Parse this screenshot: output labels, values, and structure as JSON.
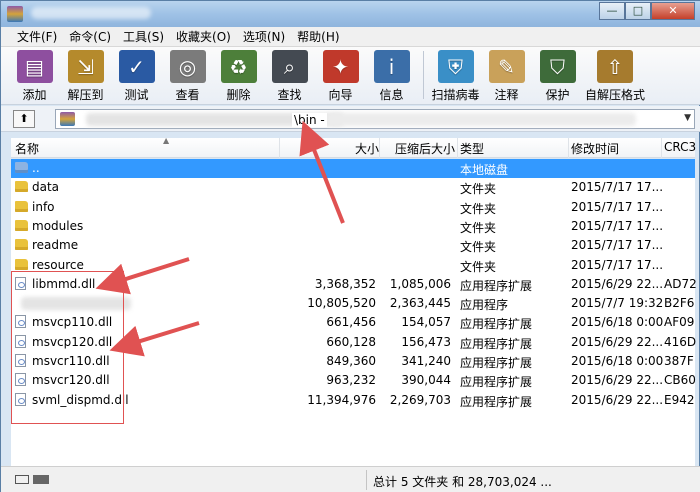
{
  "menu": [
    "文件(F)",
    "命令(C)",
    "工具(S)",
    "收藏夹(O)",
    "选项(N)",
    "帮助(H)"
  ],
  "toolbar": [
    {
      "label": "添加",
      "icon": "add-archive-icon",
      "color": "#8e4f9f"
    },
    {
      "label": "解压到",
      "icon": "extract-to-icon",
      "color": "#b58a2c"
    },
    {
      "label": "测试",
      "icon": "test-icon",
      "color": "#2a5aa3"
    },
    {
      "label": "查看",
      "icon": "view-icon",
      "color": "#7b7b7b"
    },
    {
      "label": "删除",
      "icon": "delete-icon",
      "color": "#4d7f3a"
    },
    {
      "label": "查找",
      "icon": "find-icon",
      "color": "#444a52"
    },
    {
      "label": "向导",
      "icon": "wizard-icon",
      "color": "#c0392b"
    },
    {
      "label": "信息",
      "icon": "info-icon",
      "color": "#3b6ea8"
    },
    {
      "label": "扫描病毒",
      "icon": "scan-virus-icon",
      "color": "#3a8fc7"
    },
    {
      "label": "注释",
      "icon": "comment-icon",
      "color": "#c9a15a"
    },
    {
      "label": "保护",
      "icon": "protect-icon",
      "color": "#3e6b3a"
    },
    {
      "label": "自解压格式",
      "icon": "sfx-icon",
      "color": "#a67b2e"
    }
  ],
  "address": {
    "path_visible": "\\bin - "
  },
  "columns": [
    "名称",
    "大小",
    "压缩后大小",
    "类型",
    "修改时间",
    "CRC3"
  ],
  "rows": [
    {
      "name": "..",
      "size": "",
      "packed": "",
      "type": "本地磁盘",
      "modified": "",
      "crc": "",
      "icon": "folder-up-icon",
      "selected": true
    },
    {
      "name": "data",
      "size": "",
      "packed": "",
      "type": "文件夹",
      "modified": "2015/7/17 17...",
      "crc": "",
      "icon": "folder-icon"
    },
    {
      "name": "info",
      "size": "",
      "packed": "",
      "type": "文件夹",
      "modified": "2015/7/17 17...",
      "crc": "",
      "icon": "folder-icon"
    },
    {
      "name": "modules",
      "size": "",
      "packed": "",
      "type": "文件夹",
      "modified": "2015/7/17 17...",
      "crc": "",
      "icon": "folder-icon"
    },
    {
      "name": "readme",
      "size": "",
      "packed": "",
      "type": "文件夹",
      "modified": "2015/7/17 17...",
      "crc": "",
      "icon": "folder-icon"
    },
    {
      "name": "resource",
      "size": "",
      "packed": "",
      "type": "文件夹",
      "modified": "2015/7/17 17...",
      "crc": "",
      "icon": "folder-icon"
    },
    {
      "name": "libmmd.dll",
      "size": "3,368,352",
      "packed": "1,085,006",
      "type": "应用程序扩展",
      "modified": "2015/6/29 22...",
      "crc": "AD72",
      "icon": "dll-icon"
    },
    {
      "name": "",
      "size": "10,805,520",
      "packed": "2,363,445",
      "type": "应用程序",
      "modified": "2015/7/7 19:32",
      "crc": "B2F6",
      "icon": "blurred",
      "blurred": true
    },
    {
      "name": "msvcp110.dll",
      "size": "661,456",
      "packed": "154,057",
      "type": "应用程序扩展",
      "modified": "2015/6/18 0:00",
      "crc": "AF09",
      "icon": "dll-icon"
    },
    {
      "name": "msvcp120.dll",
      "size": "660,128",
      "packed": "156,473",
      "type": "应用程序扩展",
      "modified": "2015/6/29 22...",
      "crc": "416D",
      "icon": "dll-icon"
    },
    {
      "name": "msvcr110.dll",
      "size": "849,360",
      "packed": "341,240",
      "type": "应用程序扩展",
      "modified": "2015/6/18 0:00",
      "crc": "387F",
      "icon": "dll-icon"
    },
    {
      "name": "msvcr120.dll",
      "size": "963,232",
      "packed": "390,044",
      "type": "应用程序扩展",
      "modified": "2015/6/29 22...",
      "crc": "CB60",
      "icon": "dll-icon"
    },
    {
      "name": "svml_dispmd.dll",
      "size": "11,394,976",
      "packed": "2,269,703",
      "type": "应用程序扩展",
      "modified": "2015/6/29 22...",
      "crc": "E942",
      "icon": "dll-icon"
    }
  ],
  "status": {
    "text": "总计 5 文件夹 和 28,703,024 ..."
  },
  "window_buttons": {
    "minimize": "—",
    "maximize": "□",
    "close": "✕"
  },
  "colors": {
    "selection": "#3399ff",
    "annotation": "#e05252"
  }
}
